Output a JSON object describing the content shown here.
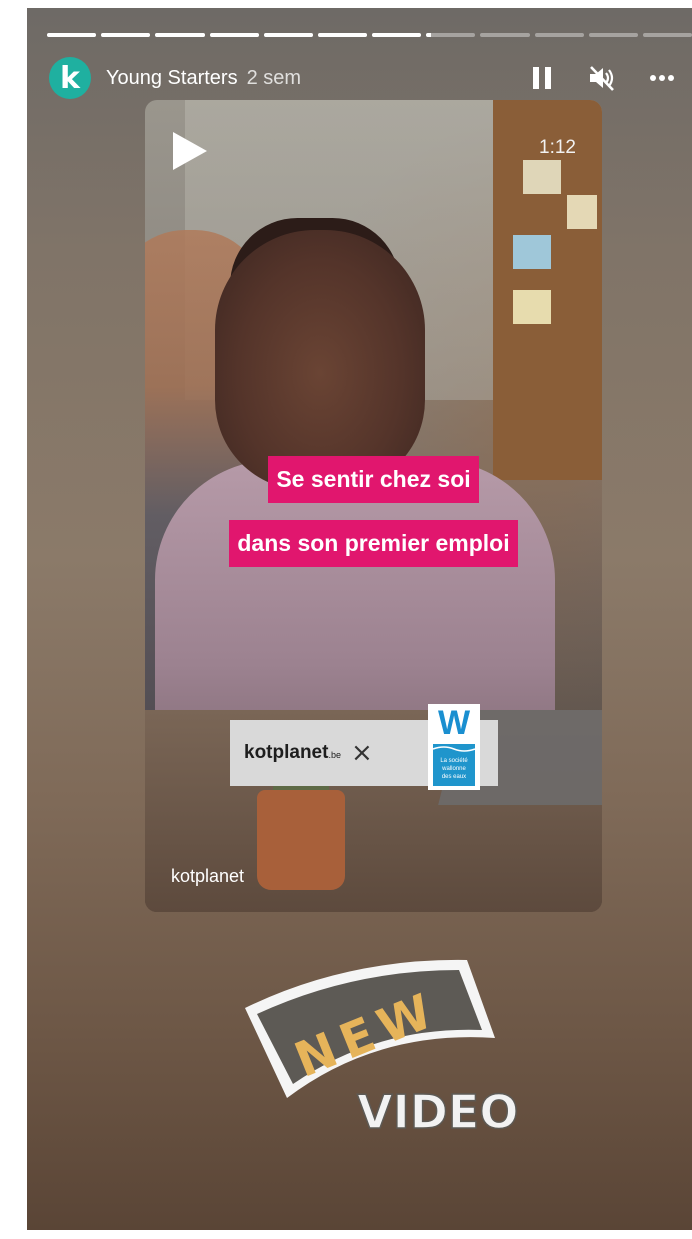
{
  "story": {
    "progress": {
      "segments": 12,
      "current_index": 7,
      "current_fraction": 0.1
    },
    "header": {
      "avatar_letter": "k",
      "account_name": "Young Starters",
      "posted_ago": "2 sem",
      "avatar_color": "#1fb0a0"
    },
    "controls": {
      "pause_icon": "pause-icon",
      "mute_icon": "speaker-muted-icon",
      "more_icon": "more-dots-icon"
    }
  },
  "video": {
    "duration": "1:12",
    "caption_lines": [
      "Se sentir chez soi",
      "dans son premier emploi"
    ],
    "caption_color": "#e1166e",
    "partner": {
      "brand": "kotplanet",
      "brand_tld": ".be",
      "separator": "×",
      "logo_letter": "W",
      "logo_text": [
        "La société",
        "wallonne",
        "des eaux"
      ]
    },
    "source_account": "kotplanet"
  },
  "sticker": {
    "word1": "NEW",
    "word2": "VIDEO"
  }
}
